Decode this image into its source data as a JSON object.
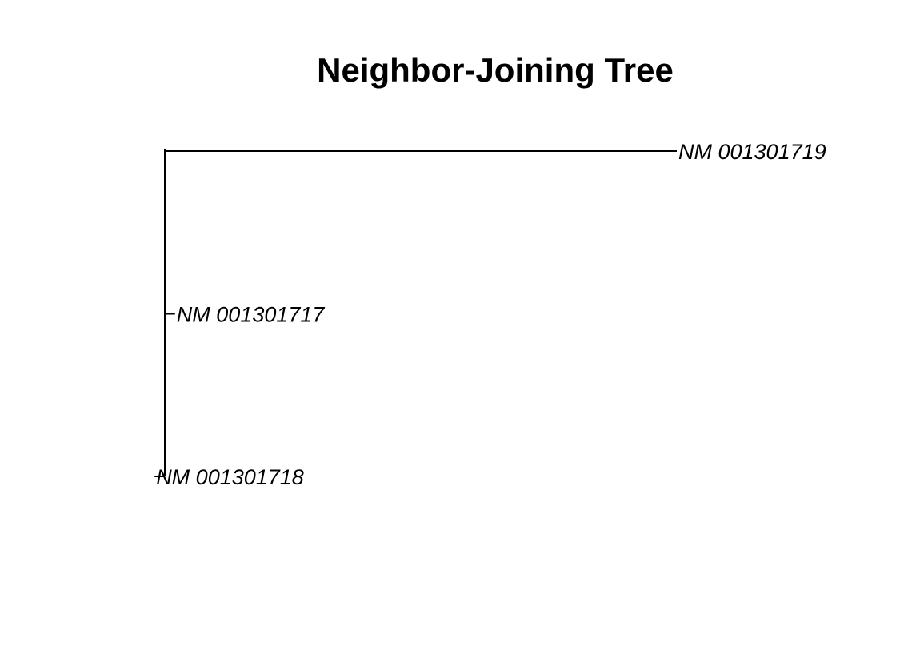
{
  "chart_data": {
    "type": "tree",
    "title": "Neighbor-Joining Tree",
    "tips": [
      {
        "label": "NM 001301719",
        "branch_length": 1.0
      },
      {
        "label": "NM 001301717",
        "branch_length": 0.02
      },
      {
        "label": "NM 001301718",
        "branch_length": -0.02
      }
    ],
    "colors": {
      "line": "#000000",
      "text": "#000000",
      "background": "#ffffff"
    }
  }
}
